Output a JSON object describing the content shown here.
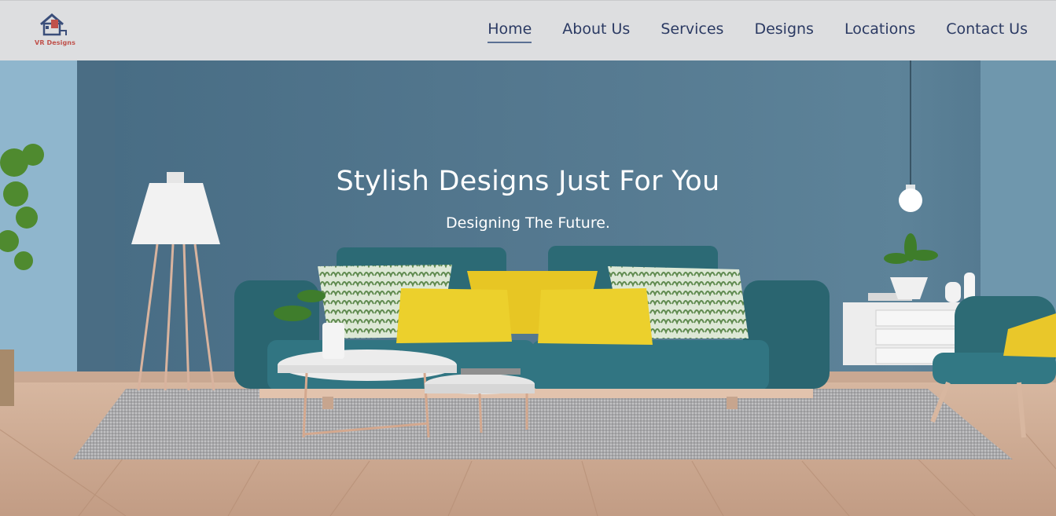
{
  "brand": {
    "name": "VR Designs",
    "logo_icon": "house-logo-icon"
  },
  "nav": {
    "items": [
      {
        "label": "Home",
        "active": true
      },
      {
        "label": "About Us",
        "active": false
      },
      {
        "label": "Services",
        "active": false
      },
      {
        "label": "Designs",
        "active": false
      },
      {
        "label": "Locations",
        "active": false
      },
      {
        "label": "Contact Us",
        "active": false
      }
    ]
  },
  "hero": {
    "title": "Stylish Designs Just For You",
    "subtitle": "Designing The Future.",
    "image_subject": "living room interior",
    "colors": {
      "wall": "#4e7289",
      "sofa": "#2f6b76",
      "cushion_yellow": "#e8c92a",
      "floor": "#c9a68f"
    }
  },
  "colors": {
    "header_bg": "#dddee0",
    "nav_text": "#2b3a63",
    "logo_accent": "#c0524c"
  }
}
